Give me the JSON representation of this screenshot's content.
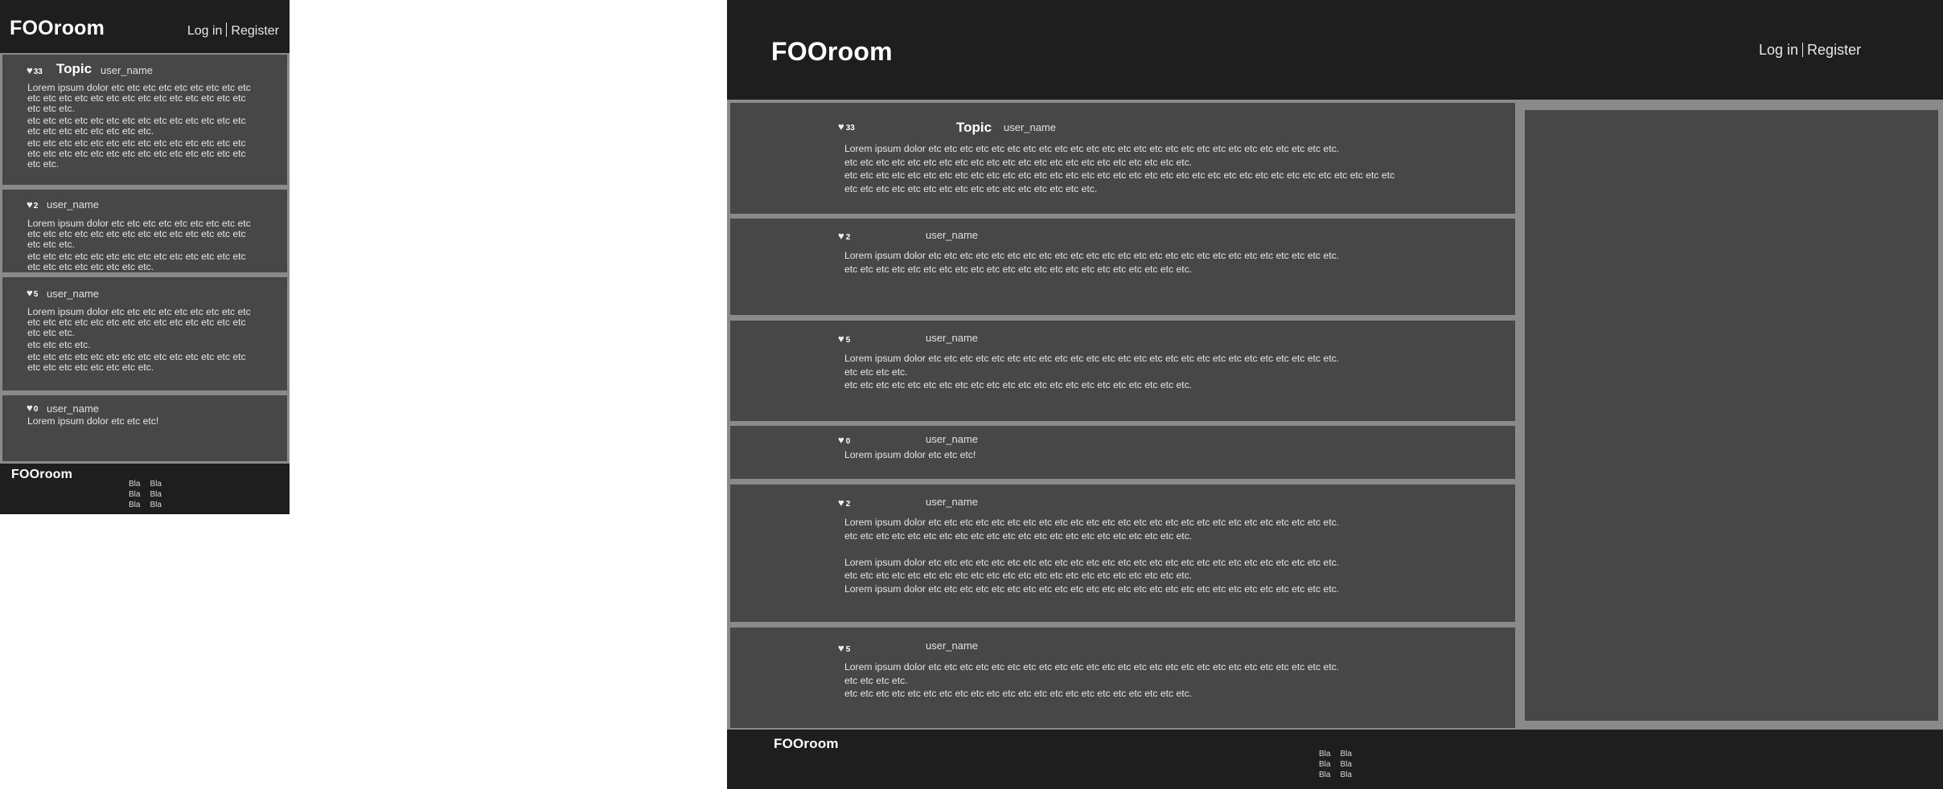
{
  "brand": "FOOroom",
  "auth": {
    "login": "Log in",
    "register": "Register"
  },
  "post1": {
    "likes": "33",
    "topic": "Topic",
    "user": "user_name",
    "m_lines": [
      "Lorem ipsum dolor etc etc etc etc etc etc etc etc etc etc etc etc etc etc etc etc etc etc etc etc etc etc etc etc etc etc.",
      "etc etc etc etc etc etc etc etc etc etc etc etc etc etc etc etc etc etc etc etc etc etc.",
      "etc etc etc etc etc etc etc etc etc etc etc etc etc etc etc etc etc etc etc etc etc etc etc etc etc etc etc etc etc etc."
    ],
    "d_lines": [
      "Lorem ipsum dolor etc etc etc etc etc etc etc etc etc etc etc etc etc etc etc etc etc etc etc etc etc etc etc etc etc etc.",
      "etc etc etc etc etc etc etc etc etc etc etc etc etc etc etc etc etc etc etc etc etc etc.",
      "etc etc etc etc etc etc etc etc etc etc etc etc etc etc etc etc etc etc etc etc etc etc etc etc etc etc etc etc etc etc etc etc etc etc etc etc etc etc etc etc etc etc etc etc etc etc etc etc etc etc etc."
    ]
  },
  "post2": {
    "likes": "2",
    "user": "user_name",
    "m_lines": [
      "Lorem ipsum dolor etc etc etc etc etc etc etc etc etc etc etc etc etc etc etc etc etc etc etc etc etc etc etc etc etc etc.",
      "etc etc etc etc etc etc etc etc etc etc etc etc etc etc etc etc etc etc etc etc etc etc."
    ],
    "d_lines": [
      "Lorem ipsum dolor etc etc etc etc etc etc etc etc etc etc etc etc etc etc etc etc etc etc etc etc etc etc etc etc etc etc.",
      "etc etc etc etc etc etc etc etc etc etc etc etc etc etc etc etc etc etc etc etc etc etc."
    ]
  },
  "post3": {
    "likes": "5",
    "user": "user_name",
    "m_lines": [
      "Lorem ipsum dolor etc etc etc etc etc etc etc etc etc etc etc etc etc etc etc etc etc etc etc etc etc etc etc etc etc etc.",
      "etc etc etc etc.",
      "etc etc etc etc etc etc etc etc etc etc etc etc etc etc etc etc etc etc etc etc etc etc."
    ],
    "d_lines": [
      "Lorem ipsum dolor etc etc etc etc etc etc etc etc etc etc etc etc etc etc etc etc etc etc etc etc etc etc etc etc etc etc.",
      "etc etc etc etc.",
      "etc etc etc etc etc etc etc etc etc etc etc etc etc etc etc etc etc etc etc etc etc etc."
    ]
  },
  "post4": {
    "likes": "0",
    "user": "user_name",
    "text": "Lorem ipsum dolor etc etc etc!"
  },
  "post5": {
    "likes": "2",
    "user": "user_name",
    "d_lines": [
      "Lorem ipsum dolor etc etc etc etc etc etc etc etc etc etc etc etc etc etc etc etc etc etc etc etc etc etc etc etc etc etc.",
      "etc etc etc etc etc etc etc etc etc etc etc etc etc etc etc etc etc etc etc etc etc etc.",
      "",
      "Lorem ipsum dolor etc etc etc etc etc etc etc etc etc etc etc etc etc etc etc etc etc etc etc etc etc etc etc etc etc etc.",
      "etc etc etc etc etc etc etc etc etc etc etc etc etc etc etc etc etc etc etc etc etc etc.",
      "Lorem ipsum dolor etc etc etc etc etc etc etc etc etc etc etc etc etc etc etc etc etc etc etc etc etc etc etc etc etc etc."
    ]
  },
  "post6": {
    "likes": "5",
    "user": "user_name",
    "d_lines": [
      "Lorem ipsum dolor etc etc etc etc etc etc etc etc etc etc etc etc etc etc etc etc etc etc etc etc etc etc etc etc etc etc.",
      "etc etc etc etc.",
      "etc etc etc etc etc etc etc etc etc etc etc etc etc etc etc etc etc etc etc etc etc etc."
    ]
  },
  "footer": {
    "links": [
      "Bla",
      "Bla",
      "Bla",
      "Bla",
      "Bla",
      "Bla"
    ]
  },
  "icons": {
    "like": "heart-icon"
  },
  "colors": {
    "header_bg": "#1e1e1e",
    "card_bg": "#474747",
    "page_bg": "#8a8a8a"
  }
}
